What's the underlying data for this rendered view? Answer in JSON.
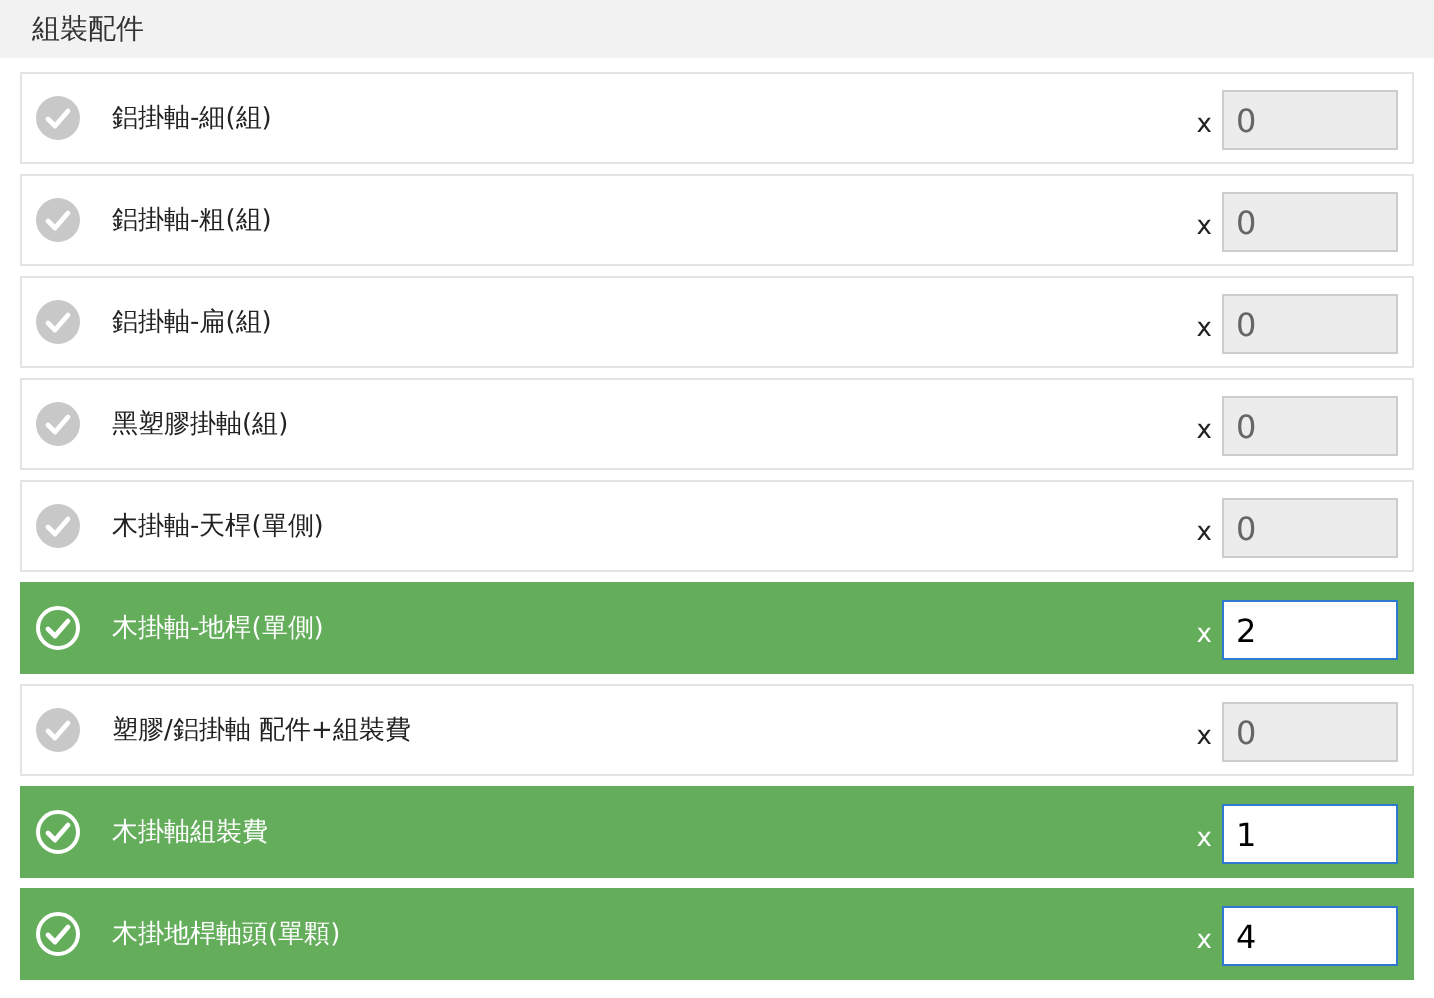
{
  "section": {
    "title": "組裝配件"
  },
  "items": [
    {
      "label": "鋁掛軸-細(組)",
      "selected": false,
      "multiplier": "x",
      "quantity": "0"
    },
    {
      "label": "鋁掛軸-粗(組)",
      "selected": false,
      "multiplier": "x",
      "quantity": "0"
    },
    {
      "label": "鋁掛軸-扁(組)",
      "selected": false,
      "multiplier": "x",
      "quantity": "0"
    },
    {
      "label": "黑塑膠掛軸(組)",
      "selected": false,
      "multiplier": "x",
      "quantity": "0"
    },
    {
      "label": "木掛軸-天桿(單側)",
      "selected": false,
      "multiplier": "x",
      "quantity": "0"
    },
    {
      "label": "木掛軸-地桿(單側)",
      "selected": true,
      "multiplier": "x",
      "quantity": "2"
    },
    {
      "label": "塑膠/鋁掛軸 配件+組裝費",
      "selected": false,
      "multiplier": "x",
      "quantity": "0"
    },
    {
      "label": "木掛軸組裝費",
      "selected": true,
      "multiplier": "x",
      "quantity": "1"
    },
    {
      "label": "木掛地桿軸頭(單顆)",
      "selected": true,
      "multiplier": "x",
      "quantity": "4"
    }
  ]
}
